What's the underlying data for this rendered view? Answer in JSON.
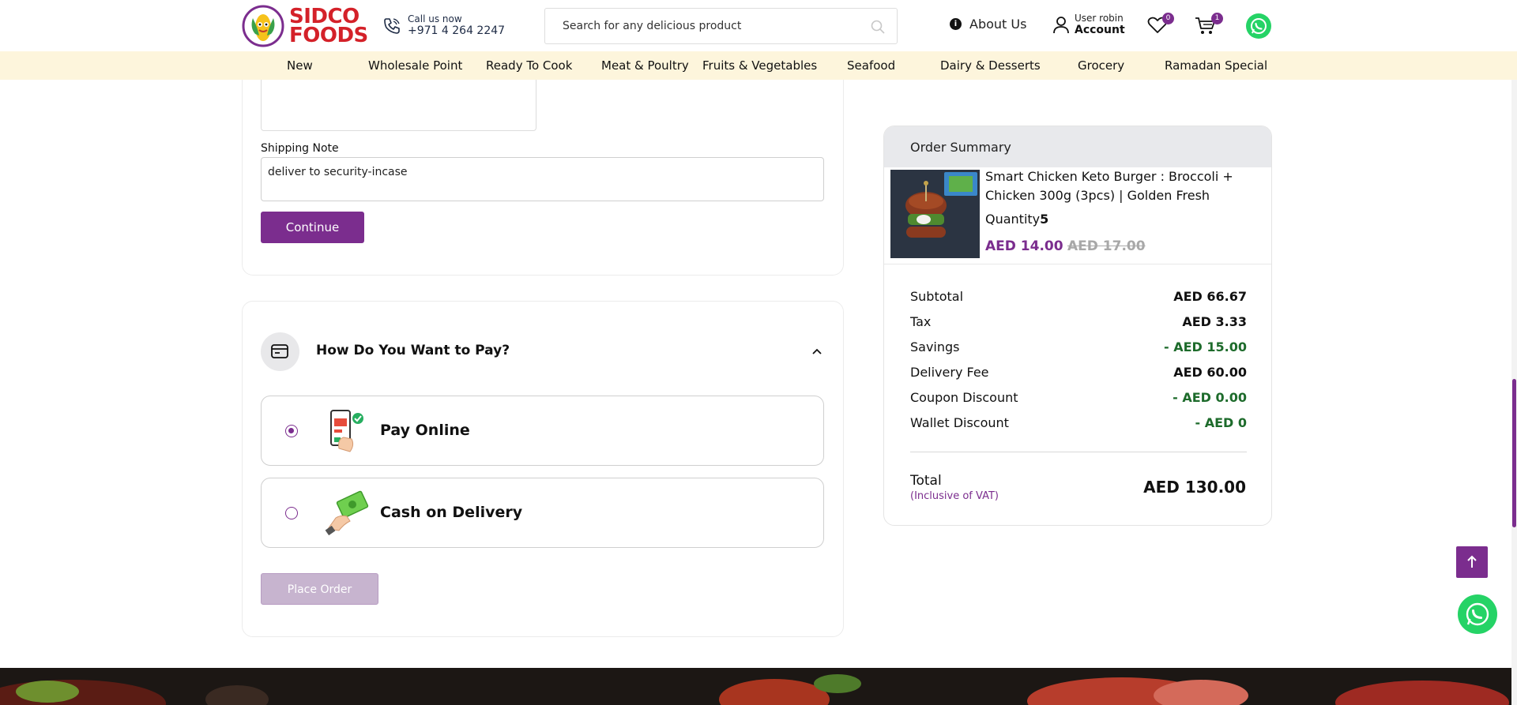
{
  "header": {
    "logo_line1": "SIDCO",
    "logo_line2": "FOODS",
    "call_label": "Call us now",
    "call_number": "+971 4 264 2247",
    "search_placeholder": "Search for any delicious product",
    "about_label": "About Us",
    "user_greeting": "User robin",
    "account_label": "Account",
    "wishlist_count": "0",
    "cart_count": "1"
  },
  "nav": {
    "items": [
      "New",
      "Wholesale Point",
      "Ready To Cook",
      "Meat & Poultry",
      "Fruits & Vegetables",
      "Seafood",
      "Dairy & Desserts",
      "Grocery",
      "Ramadan Special"
    ]
  },
  "shipping": {
    "label": "Shipping Note",
    "value": "deliver to security-incase",
    "continue_label": "Continue"
  },
  "payment": {
    "title": "How Do You Want to Pay?",
    "options": [
      {
        "label": "Pay Online",
        "selected": true
      },
      {
        "label": "Cash on Delivery",
        "selected": false
      }
    ],
    "place_order_label": "Place Order"
  },
  "summary": {
    "title": "Order Summary",
    "product": {
      "name": "Smart Chicken Keto Burger : Broccoli + Chicken 300g (3pcs) | Golden Fresh",
      "qty_label": "Quantity",
      "qty": "5",
      "price": "AED 14.00",
      "old_price": "AED 17.00"
    },
    "rows": [
      {
        "label": "Subtotal",
        "value": "AED 66.67"
      },
      {
        "label": "Tax",
        "value": "AED 3.33"
      },
      {
        "label": "Savings",
        "value": "- AED 15.00"
      },
      {
        "label": "Delivery Fee",
        "value": "AED 60.00"
      },
      {
        "label": "Coupon Discount",
        "value": "- AED 0.00"
      },
      {
        "label": "Wallet Discount",
        "value": "- AED 0"
      }
    ],
    "total_label": "Total",
    "total_note": "(Inclusive of VAT)",
    "total_value": "AED 130.00"
  },
  "colors": {
    "brand_purple": "#7b2d8e",
    "brand_red": "#d42129",
    "nav_bg": "#fdf5dc",
    "savings_green": "#1d6b2b",
    "whatsapp_green": "#25d366"
  },
  "icons": {
    "call": "phone-icon",
    "search": "search-icon",
    "about": "info-icon",
    "account": "user-icon",
    "wishlist": "heart-icon",
    "cart": "cart-icon",
    "whatsapp": "whatsapp-icon",
    "payment": "card-icon",
    "collapse": "chevron-up-icon",
    "scroll_top": "arrow-up-icon"
  }
}
